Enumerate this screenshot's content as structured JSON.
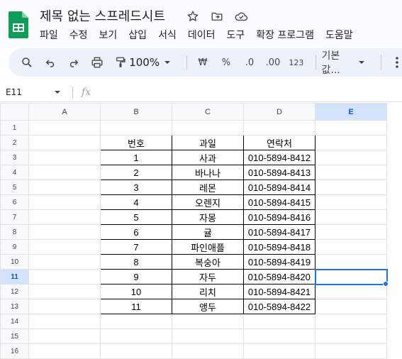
{
  "app": {
    "doc_title": "제목 없는 스프레드시트",
    "menu": [
      "파일",
      "수정",
      "보기",
      "삽입",
      "서식",
      "데이터",
      "도구",
      "확장 프로그램",
      "도움말"
    ]
  },
  "toolbar": {
    "zoom": "100%",
    "currency": "₩",
    "percent": "%",
    "dec_decrease": ".0",
    "dec_increase": ".00",
    "number_format": "123",
    "font": "기본값..."
  },
  "formula_bar": {
    "cell_ref": "E11",
    "fx_label": "fx",
    "value": ""
  },
  "sheet": {
    "columns": [
      "A",
      "B",
      "C",
      "D",
      "E"
    ],
    "rows": [
      "1",
      "2",
      "3",
      "4",
      "5",
      "6",
      "7",
      "8",
      "9",
      "10",
      "11",
      "12",
      "13",
      "14",
      "15",
      "16"
    ],
    "selected_cell": "E11",
    "headers": [
      "번호",
      "과일",
      "연락처"
    ],
    "data": [
      [
        "1",
        "사과",
        "010-5894-8412"
      ],
      [
        "2",
        "바나나",
        "010-5894-8413"
      ],
      [
        "3",
        "레몬",
        "010-5894-8414"
      ],
      [
        "4",
        "오렌지",
        "010-5894-8415"
      ],
      [
        "5",
        "자몽",
        "010-5894-8416"
      ],
      [
        "6",
        "귤",
        "010-5894-8417"
      ],
      [
        "7",
        "파인애플",
        "010-5894-8418"
      ],
      [
        "8",
        "복숭아",
        "010-5894-8419"
      ],
      [
        "9",
        "자두",
        "010-5894-8420"
      ],
      [
        "10",
        "리치",
        "010-5894-8421"
      ],
      [
        "11",
        "앵두",
        "010-5894-8422"
      ]
    ]
  }
}
